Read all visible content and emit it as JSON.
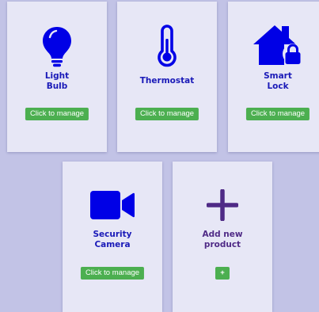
{
  "products": [
    {
      "label": "Light\nBulb",
      "icon": "lightbulb-icon",
      "button": "Click to manage"
    },
    {
      "label": "Thermostat",
      "icon": "thermometer-icon",
      "button": "Click to manage"
    },
    {
      "label": "Smart\nLock",
      "icon": "house-lock-icon",
      "button": "Click to manage"
    },
    {
      "label": "Security\nCamera",
      "icon": "video-camera-icon",
      "button": "Click to manage"
    }
  ],
  "add_product": {
    "label": "Add new\nproduct",
    "icon": "plus-icon",
    "button": "+"
  },
  "colors": {
    "background": "#c2c3e6",
    "card": "#e7e7f6",
    "icon": "#0000e6",
    "label": "#1a1ab8",
    "add_accent": "#4f2a86",
    "button": "#4caf50"
  }
}
